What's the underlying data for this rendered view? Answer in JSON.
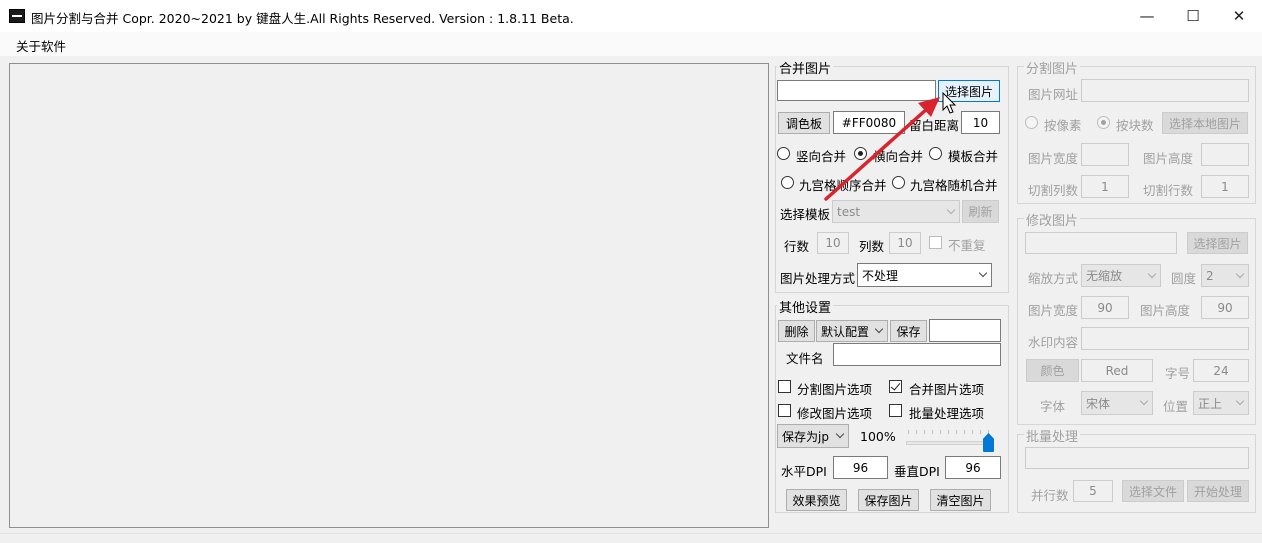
{
  "window": {
    "title": "图片分割与合并    Copr. 2020~2021 by 键盘人生.All Rights Reserved.  Version : 1.8.11 Beta.",
    "minimize_glyph": "—",
    "maximize_glyph": "☐",
    "close_glyph": "✕"
  },
  "menu": {
    "about": "关于软件"
  },
  "merge": {
    "title": "合并图片",
    "path_value": "",
    "select_image": "选择图片",
    "palette": "调色板",
    "color_value": "#FF0080",
    "margin_label": "留白距离",
    "margin_value": "10",
    "vertical": "竖向合并",
    "horizontal": "横向合并",
    "template": "模板合并",
    "grid_seq": "九宫格顺序合并",
    "grid_rand": "九宫格随机合并",
    "select_template_label": "选择模板",
    "template_value": "test",
    "refresh": "刷新",
    "rows_label": "行数",
    "rows_value": "10",
    "cols_label": "列数",
    "cols_value": "10",
    "no_repeat": "不重复",
    "processing_label": "图片处理方式",
    "processing_value": "不处理"
  },
  "other": {
    "title": "其他设置",
    "delete": "删除",
    "config_value": "默认配置",
    "save": "保存",
    "config_name": "",
    "filename_label": "文件名",
    "filename_value": "",
    "split_opt": "分割图片选项",
    "merge_opt": "合并图片选项",
    "modify_opt": "修改图片选项",
    "batch_opt": "批量处理选项",
    "format_value": "保存为jp",
    "quality": "100%",
    "quality_level": 100,
    "hdpi_label": "水平DPI",
    "hdpi_value": "96",
    "vdpi_label": "垂直DPI",
    "vdpi_value": "96",
    "preview": "效果预览",
    "save_image": "保存图片",
    "clear_image": "清空图片"
  },
  "split": {
    "title": "分割图片",
    "url_label": "图片网址",
    "url_value": "",
    "by_pixel": "按像素",
    "by_count": "按块数",
    "select_local": "选择本地图片",
    "width_label": "图片宽度",
    "width_value": "",
    "height_label": "图片高度",
    "height_value": "",
    "cols_label": "切割列数",
    "cols_value": "1",
    "rows_label": "切割行数",
    "rows_value": "1"
  },
  "modify": {
    "title": "修改图片",
    "path_value": "",
    "select_image": "选择图片",
    "scale_label": "缩放方式",
    "scale_value": "无缩放",
    "round_label": "圆度",
    "round_value": "2",
    "width_label": "图片宽度",
    "width_value": "90",
    "height_label": "图片高度",
    "height_value": "90",
    "watermark_label": "水印内容",
    "watermark_value": "",
    "color_btn": "颜色",
    "color_value": "Red",
    "fontsize_label": "字号",
    "fontsize_value": "24",
    "font_label": "字体",
    "font_value": "宋体",
    "position_label": "位置",
    "position_value": "正上"
  },
  "batch": {
    "title": "批量处理",
    "path_value": "",
    "parallel_label": "并行数",
    "parallel_value": "5",
    "select_folder": "选择文件",
    "start_process": "开始处理"
  },
  "colors": {
    "accent": "#0078d7",
    "annotation": "#d9232e",
    "slider": "#0078d7"
  }
}
